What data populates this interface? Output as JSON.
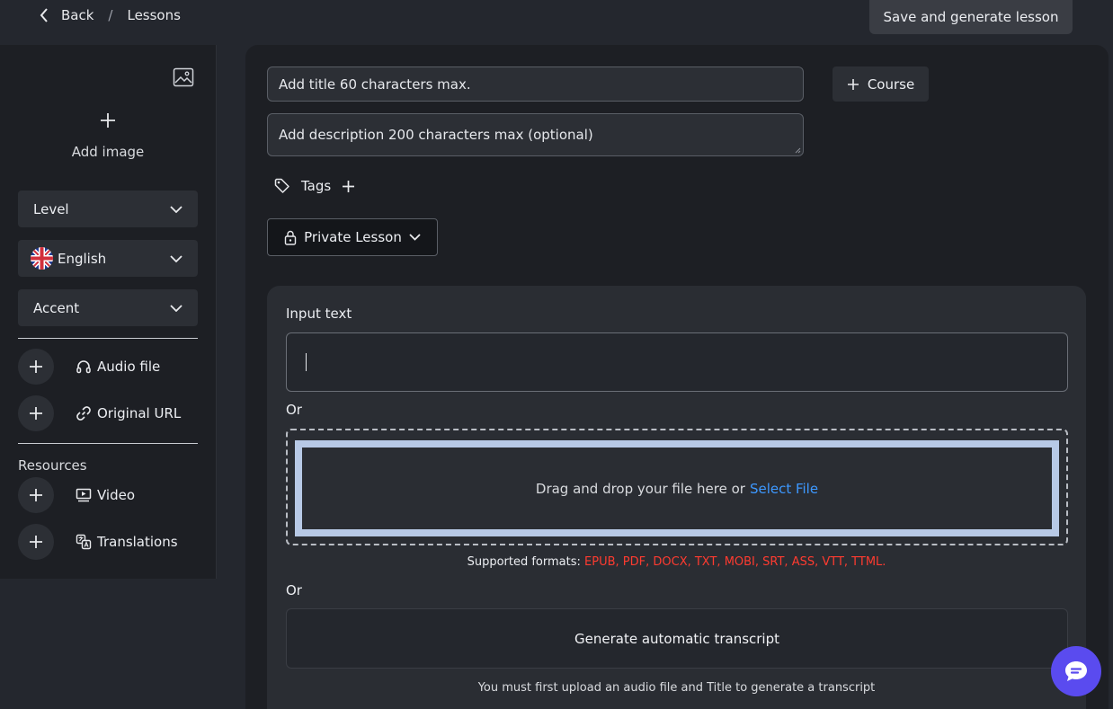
{
  "nav": {
    "back_label": "Back",
    "separator": "/",
    "breadcrumb": "Lessons"
  },
  "toolbar": {
    "save_label": "Save and generate lesson"
  },
  "sidebar": {
    "add_image_label": "Add image",
    "level_label": "Level",
    "language_label": "English",
    "accent_label": "Accent",
    "audio_file_label": "Audio file",
    "original_url_label": "Original URL",
    "resources_label": "Resources",
    "video_label": "Video",
    "translations_label": "Translations"
  },
  "form": {
    "title_placeholder": "Add title 60 characters max.",
    "description_placeholder": "Add description 200 characters max (optional)",
    "course_label": "Course",
    "tags_label": "Tags",
    "privacy_label": "Private Lesson"
  },
  "content": {
    "input_text_label": "Input text",
    "or_label": "Or",
    "drop_text": "Drag and drop your file here or",
    "select_file_label": "Select File",
    "supported_label": "Supported formats:",
    "formats": "EPUB, PDF, DOCX, TXT, MOBI, SRT, ASS, VTT, TTML.",
    "generate_label": "Generate automatic transcript",
    "generate_note": "You must first upload an audio file and Title to generate a transcript"
  },
  "colors": {
    "accent_blue": "#3d98ff",
    "formats_red": "#ff3b30",
    "chat_purple": "#5a4bef"
  },
  "icons": [
    "chevron-left-icon",
    "image-icon",
    "plus-icon",
    "chevron-down-icon",
    "uk-flag-icon",
    "headphones-icon",
    "link-icon",
    "video-icon",
    "translate-icon",
    "tag-icon",
    "lock-icon",
    "chat-icon"
  ]
}
